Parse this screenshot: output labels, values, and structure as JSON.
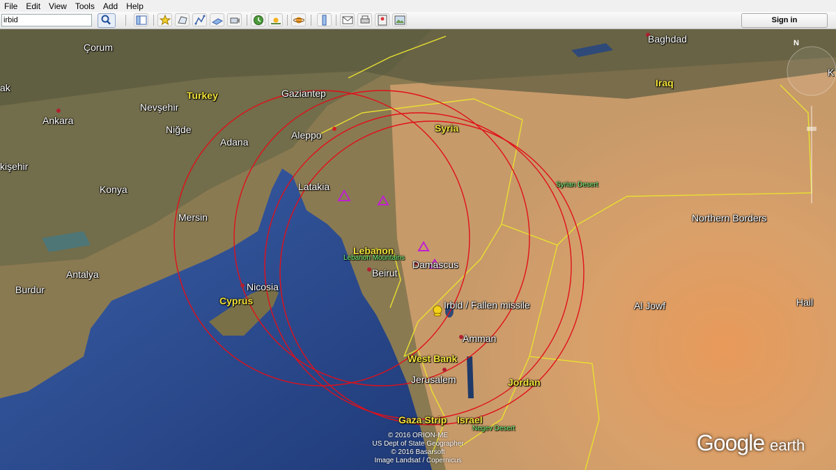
{
  "menu": [
    "File",
    "Edit",
    "View",
    "Tools",
    "Add",
    "Help"
  ],
  "search": {
    "value": "irbid"
  },
  "toolbar": {
    "signin_label": "Sign in"
  },
  "map": {
    "cities": {
      "baghdad": "Baghdad",
      "corum": "Çorum",
      "ak": "ak",
      "nevsehir": "Nevşehir",
      "ankara": "Ankara",
      "nigde": "Niğde",
      "adana": "Adana",
      "gaziantep": "Gaziantep",
      "aleppo": "Aleppo",
      "kisehir": "kişehir",
      "konya": "Konya",
      "latakia": "Latakia",
      "mersin": "Mersin",
      "beirut": "Beirut",
      "damascus": "Damascus",
      "nicosia": "Nicosia",
      "antalya": "Antalya",
      "burdur": "Burdur",
      "amman": "Amman",
      "jerusalem": "Jerusalem",
      "irbid": "Irbid / Fallen missile",
      "al_jouf": "Al Jowf",
      "hail": "Hail",
      "northern_borders": "Northern Borders",
      "k": "K"
    },
    "countries": {
      "turkey": "Turkey",
      "syria": "Syria",
      "iraq": "Iraq",
      "lebanon": "Lebanon",
      "cyprus": "Cyprus",
      "west_bank": "West Bank",
      "jordan": "Jordan",
      "gaza": "Gaza Strip",
      "israel": "Israel"
    },
    "features": {
      "syrian_desert": "Syrian Desert",
      "lebanon_mountains": "Lebanon Mountains",
      "negev": "Negev Desert"
    },
    "attribution": [
      "© 2016 ORION-ME",
      "US Dept of State Geographer",
      "© 2016 Basarsoft",
      "Image Landsat / Copernicus"
    ],
    "logo": {
      "main": "Google",
      "sub": "earth"
    },
    "colors": {
      "circles": "#e0101a",
      "borders": "#e8e030",
      "markers": "#c020d0",
      "pin": "#f4d21a"
    }
  }
}
